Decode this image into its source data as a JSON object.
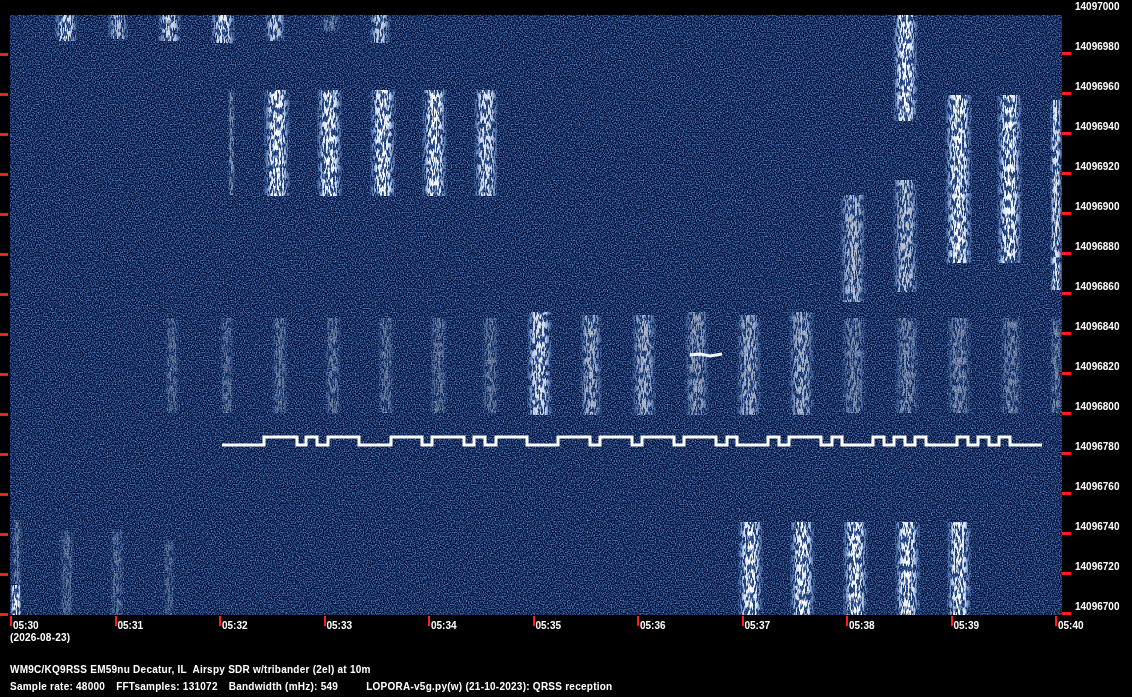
{
  "spectrogram": {
    "frequency_labels": [
      "14097000",
      "14096980",
      "14096960",
      "14096940",
      "14096920",
      "14096900",
      "14096880",
      "14096860",
      "14096840",
      "14096820",
      "14096800",
      "14096780",
      "14096760",
      "14096740",
      "14096720",
      "14096700"
    ],
    "time_labels": [
      "05:30",
      "05:31",
      "05:32",
      "05:33",
      "05:34",
      "05:35",
      "05:36",
      "05:37",
      "05:38",
      "05:39",
      "05:40"
    ],
    "date": "(2026-08-23)"
  },
  "footer": {
    "station": "WM9C/KQ9RSS EM59nu Decatur, IL  Airspy SDR w/tribander (2el) at 10m",
    "settings": [
      "Sample rate: 48000",
      "FFTsamples: 131072",
      "Bandwidth (mHz): 549",
      "LOPORA-v5g.py(w) (21-10-2023): QRSS reception"
    ]
  }
}
